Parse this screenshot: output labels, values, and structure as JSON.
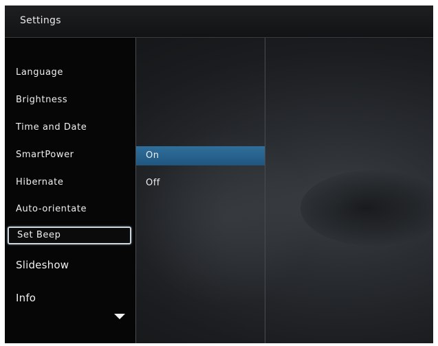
{
  "header": {
    "title": "Settings"
  },
  "menu": {
    "items": [
      {
        "label": "Language"
      },
      {
        "label": "Brightness"
      },
      {
        "label": "Time and Date"
      },
      {
        "label": "SmartPower"
      },
      {
        "label": "Hibernate"
      },
      {
        "label": "Auto-orientate"
      },
      {
        "label": "Set Beep",
        "selected": true
      },
      {
        "label": "Slideshow"
      },
      {
        "label": "Info"
      }
    ],
    "more_icon": "chevron-down-icon"
  },
  "options": {
    "items": [
      {
        "label": "On",
        "highlighted": true
      },
      {
        "label": "Off"
      }
    ]
  },
  "colors": {
    "highlight": "#2a6590",
    "selection_border": "#cfd6dc",
    "text": "#f0f0f0"
  }
}
